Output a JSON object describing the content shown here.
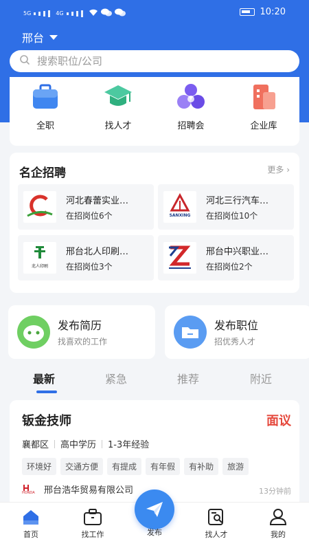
{
  "status_bar": {
    "time": "10:20",
    "network_labels": [
      "5G",
      "4G"
    ]
  },
  "header": {
    "city": "邢台"
  },
  "search": {
    "placeholder": "搜索职位/公司"
  },
  "categories": [
    {
      "label": "全职",
      "icon": "briefcase-icon"
    },
    {
      "label": "找人才",
      "icon": "graduation-cap-icon"
    },
    {
      "label": "招聘会",
      "icon": "job-fair-icon"
    },
    {
      "label": "企业库",
      "icon": "building-icon"
    }
  ],
  "famous_companies": {
    "title": "名企招聘",
    "more": "更多",
    "items": [
      {
        "name": "河北春蕾实业…",
        "jobs": "在招岗位6个",
        "logo_text": ""
      },
      {
        "name": "河北三行汽车…",
        "jobs": "在招岗位10个",
        "logo_text": "SANXING"
      },
      {
        "name": "邢台北人印刷…",
        "jobs": "在招岗位3个",
        "logo_text": "北人印刷"
      },
      {
        "name": "邢台中兴职业…",
        "jobs": "在招岗位2个",
        "logo_text": ""
      }
    ]
  },
  "actions": [
    {
      "title": "发布简历",
      "subtitle": "找喜欢的工作"
    },
    {
      "title": "发布职位",
      "subtitle": "招优秀人才"
    }
  ],
  "feed_tabs": [
    {
      "label": "最新",
      "active": true
    },
    {
      "label": "紧急",
      "active": false
    },
    {
      "label": "推荐",
      "active": false
    },
    {
      "label": "附近",
      "active": false
    }
  ],
  "job": {
    "title": "钣金技师",
    "salary": "面议",
    "district": "襄都区",
    "education": "高中学历",
    "experience": "1-3年经验",
    "tags": [
      "环境好",
      "交通方便",
      "有提成",
      "有年假",
      "有补助",
      "旅游"
    ],
    "company": "邢台浩华贸易有限公司",
    "company_logo_text": "HONDA",
    "time": "13分钟前"
  },
  "tabbar": {
    "items": [
      {
        "label": "首页",
        "icon": "home-icon"
      },
      {
        "label": "找工作",
        "icon": "briefcase-icon"
      },
      {
        "label": "发布",
        "icon": "paper-plane-icon"
      },
      {
        "label": "找人才",
        "icon": "search-person-icon"
      },
      {
        "label": "我的",
        "icon": "user-icon"
      }
    ]
  },
  "colors": {
    "primary": "#2f6fe6",
    "salary": "#e5483c",
    "background": "#f3f5f8"
  }
}
